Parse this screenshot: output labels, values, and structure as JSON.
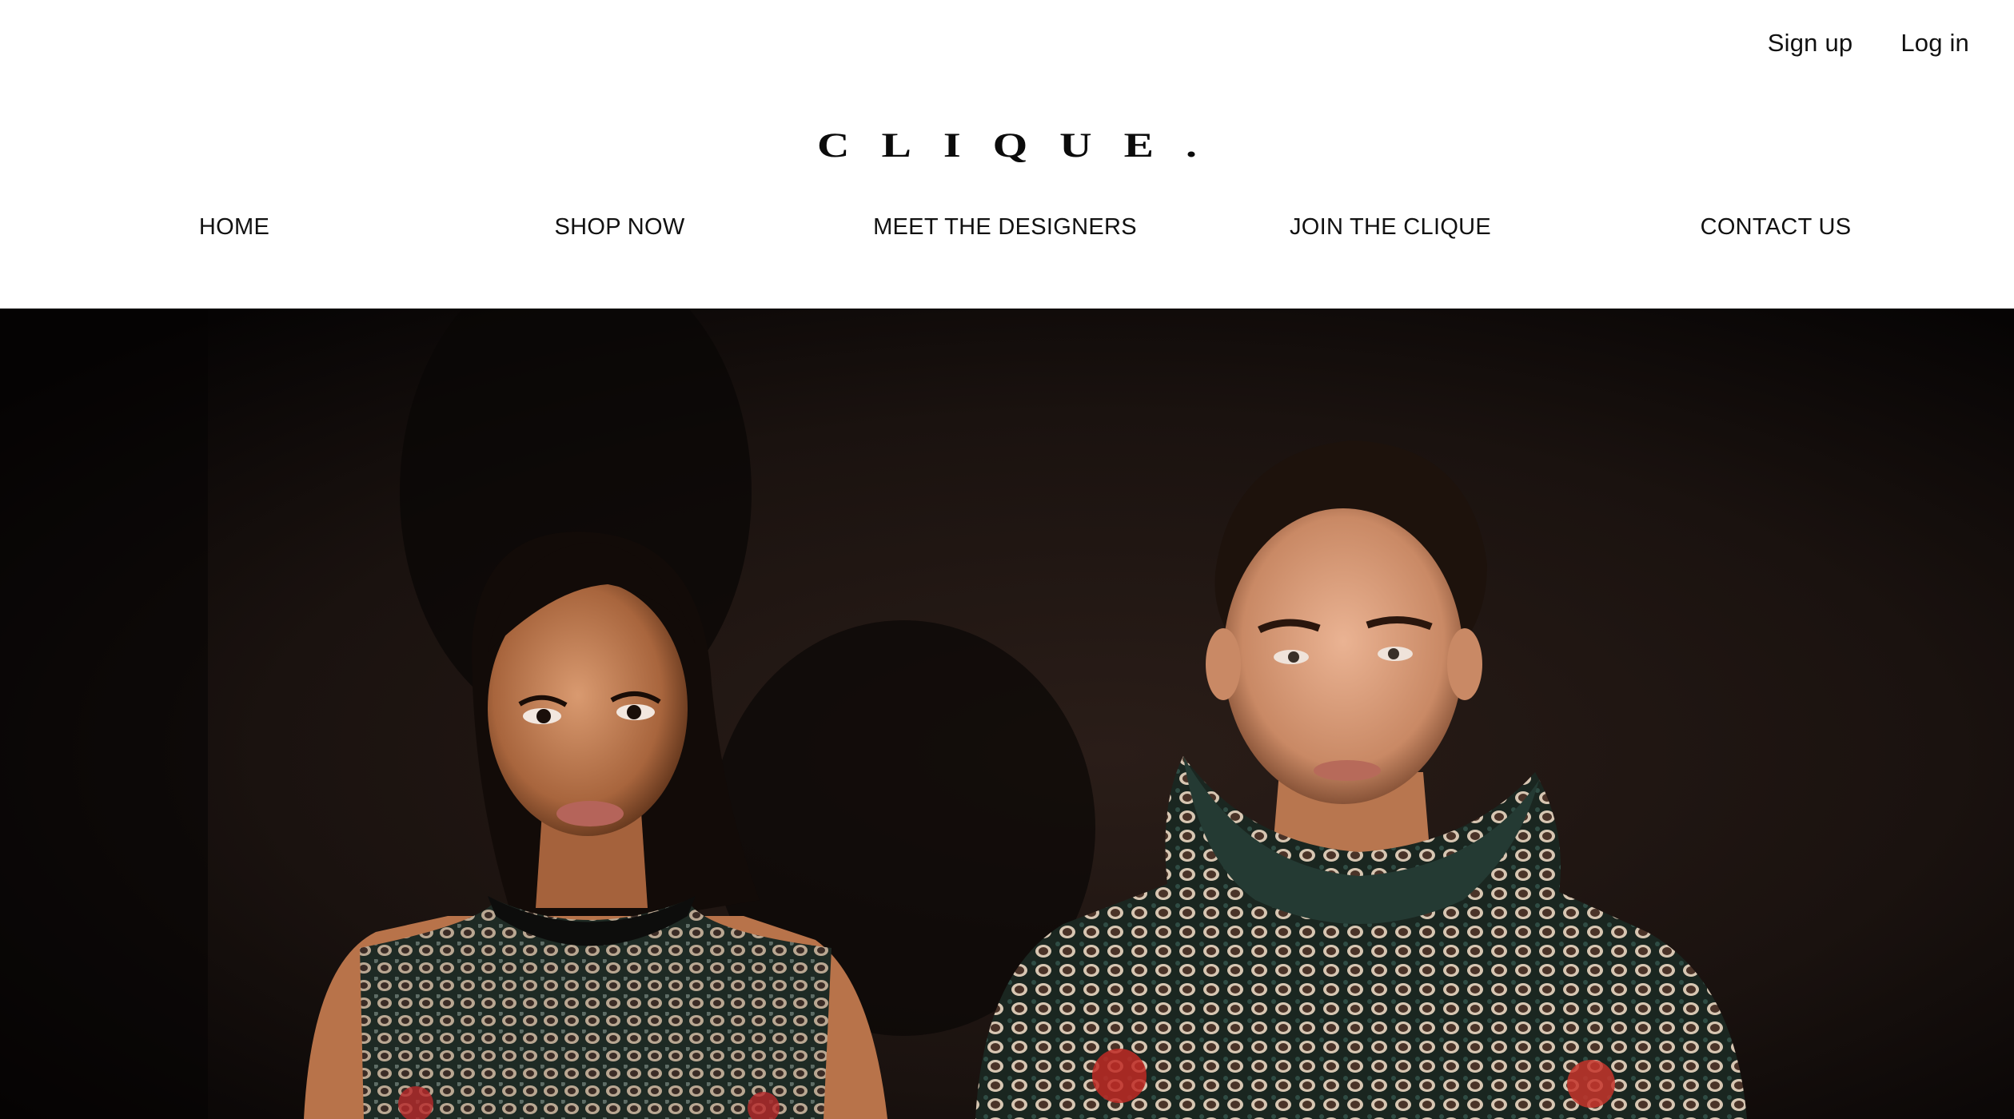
{
  "header": {
    "auth": {
      "signup_label": "Sign up",
      "login_label": "Log in"
    },
    "logo_text": "CLIQUE."
  },
  "nav": {
    "items": [
      {
        "label": "HOME"
      },
      {
        "label": "SHOP NOW"
      },
      {
        "label": "MEET THE DESIGNERS"
      },
      {
        "label": "JOIN THE CLIQUE"
      },
      {
        "label": "CONTACT US"
      }
    ]
  },
  "hero": {
    "subject": "two models wearing patterned garments against a dark backdrop"
  },
  "colors": {
    "background": "#ffffff",
    "text": "#111111",
    "hero_backdrop": "#140e0c"
  }
}
